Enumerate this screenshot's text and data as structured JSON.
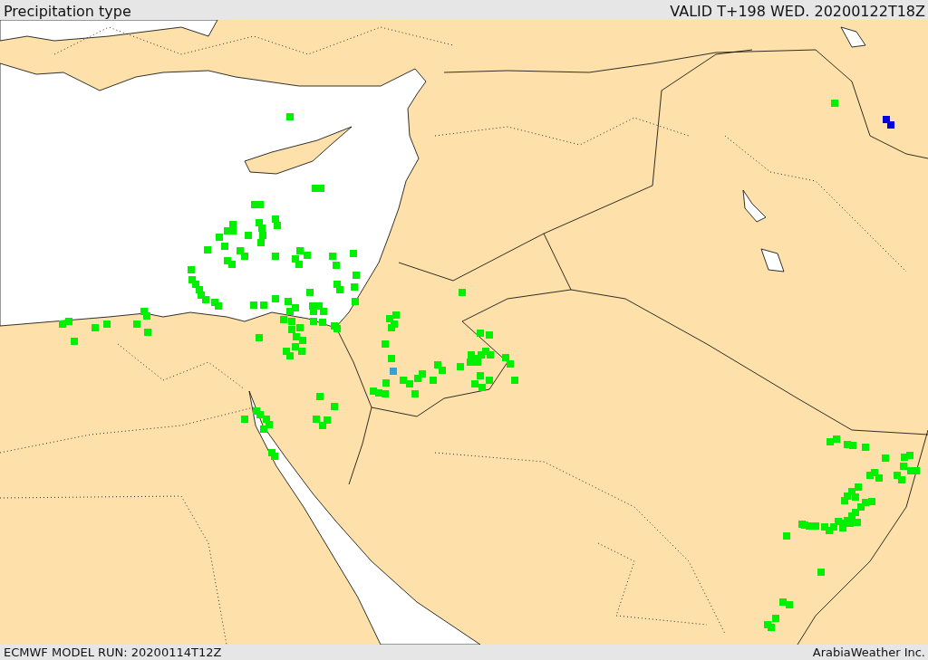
{
  "header": {
    "title": "Precipitation type",
    "valid": "VALID T+198 WED. 20200122T18Z"
  },
  "footer": {
    "model_run": "ECMWF MODEL RUN: 20200114T12Z",
    "credit": "ArabiaWeather Inc."
  }
}
